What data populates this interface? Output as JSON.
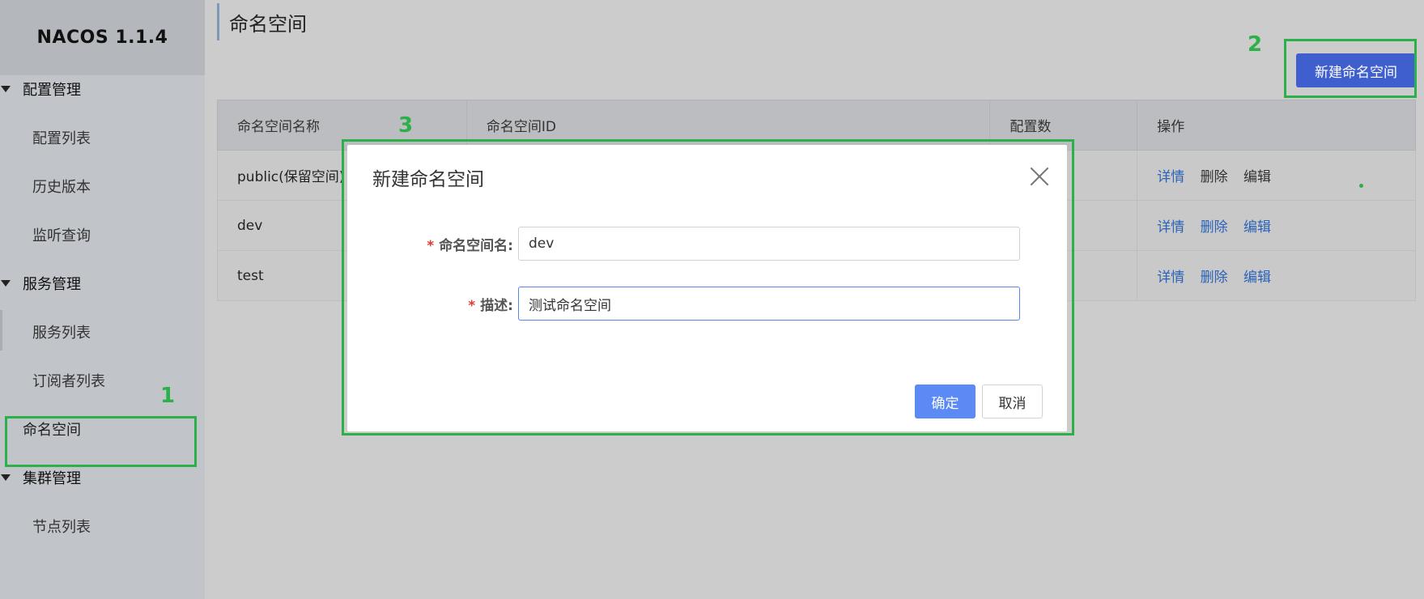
{
  "app": {
    "logo": "NACOS 1.1.4"
  },
  "sidebar": {
    "groups": [
      {
        "label": "配置管理",
        "items": [
          "配置列表",
          "历史版本",
          "监听查询"
        ]
      },
      {
        "label": "服务管理",
        "items": [
          "服务列表",
          "订阅者列表",
          "命名空间"
        ]
      },
      {
        "label": "集群管理",
        "items": [
          "节点列表"
        ]
      }
    ],
    "active_item": "命名空间"
  },
  "page": {
    "title": "命名空间",
    "create_button": "新建命名空间"
  },
  "table": {
    "headers": [
      "命名空间名称",
      "命名空间ID",
      "配置数",
      "操作"
    ],
    "rows": [
      {
        "name": "public(保留空间)"
      },
      {
        "name": "dev"
      },
      {
        "name": "test"
      }
    ],
    "actions": [
      "详情",
      "删除",
      "编辑"
    ]
  },
  "modal": {
    "title": "新建命名空间",
    "fields": [
      {
        "label": "命名空间名:",
        "value": "dev",
        "required": "*"
      },
      {
        "label": "描述:",
        "value": "测试命名空间",
        "required": "*"
      }
    ],
    "ok_label": "确定",
    "cancel_label": "取消"
  },
  "annotations": {
    "labels": [
      "1",
      "2",
      "3"
    ],
    "color": "#2bb04a"
  },
  "colors": {
    "primary": "#3f5fcf",
    "link": "#2a63b8",
    "required": "#e03b2c"
  }
}
